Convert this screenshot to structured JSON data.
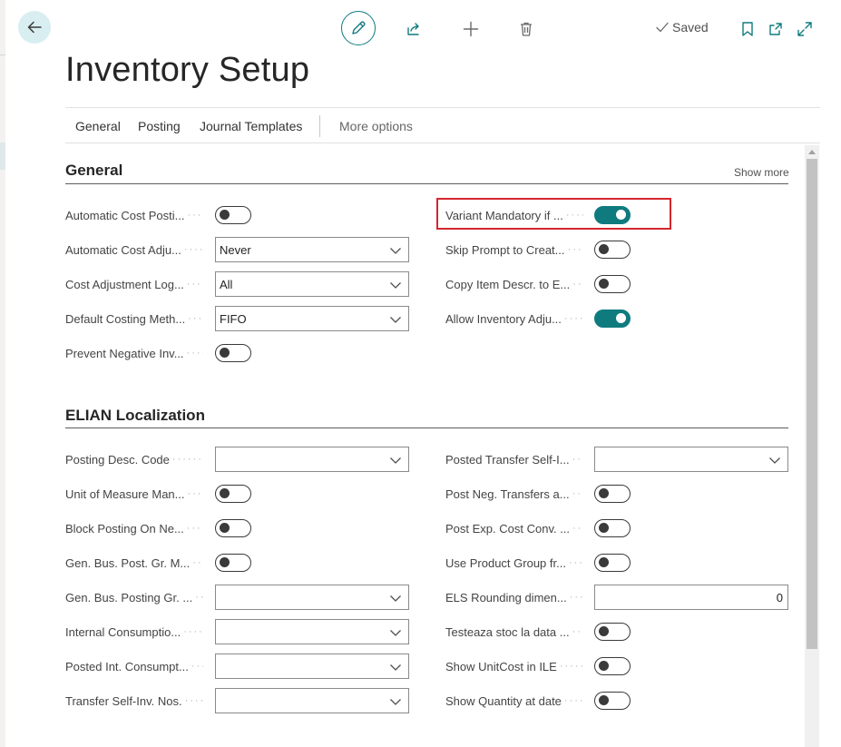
{
  "header": {
    "title": "Inventory Setup",
    "saved_label": "Saved"
  },
  "icons": {
    "back": "arrow-left-icon",
    "edit": "pencil-icon",
    "share": "share-icon",
    "new": "plus-icon",
    "delete": "trash-icon",
    "saved": "check-icon",
    "bookmark": "bookmark-icon",
    "open_new_window": "open-in-new-window-icon",
    "expand": "expand-icon"
  },
  "tabs": [
    {
      "label": "General"
    },
    {
      "label": "Posting"
    },
    {
      "label": "Journal Templates"
    },
    {
      "label": "More options"
    }
  ],
  "general": {
    "title": "General",
    "show_more": "Show more",
    "left_fields": [
      {
        "label": "Automatic Cost Posti...",
        "type": "toggle",
        "value": false
      },
      {
        "label": "Automatic Cost Adju...",
        "type": "select",
        "value": "Never"
      },
      {
        "label": "Cost Adjustment Log...",
        "type": "select",
        "value": "All"
      },
      {
        "label": "Default Costing Meth...",
        "type": "select",
        "value": "FIFO"
      },
      {
        "label": "Prevent Negative Inv...",
        "type": "toggle",
        "value": false
      }
    ],
    "right_fields": [
      {
        "label": "Variant Mandatory if ...",
        "type": "toggle",
        "value": true,
        "highlighted": true
      },
      {
        "label": "Skip Prompt to Creat...",
        "type": "toggle",
        "value": false
      },
      {
        "label": "Copy Item Descr. to E...",
        "type": "toggle",
        "value": false
      },
      {
        "label": "Allow Inventory Adju...",
        "type": "toggle",
        "value": true
      }
    ]
  },
  "elian": {
    "title": "ELIAN Localization",
    "left_fields": [
      {
        "label": "Posting Desc. Code",
        "type": "select",
        "value": ""
      },
      {
        "label": "Unit of Measure Man...",
        "type": "toggle",
        "value": false
      },
      {
        "label": "Block Posting On Ne...",
        "type": "toggle",
        "value": false
      },
      {
        "label": "Gen. Bus. Post. Gr. M...",
        "type": "toggle",
        "value": false
      },
      {
        "label": "Gen. Bus. Posting Gr. ...",
        "type": "select",
        "value": ""
      },
      {
        "label": "Internal Consumptio...",
        "type": "select",
        "value": ""
      },
      {
        "label": "Posted Int. Consumpt...",
        "type": "select",
        "value": ""
      },
      {
        "label": "Transfer Self-Inv. Nos.",
        "type": "select",
        "value": ""
      }
    ],
    "right_fields": [
      {
        "label": "Posted Transfer Self-I...",
        "type": "select",
        "value": ""
      },
      {
        "label": "Post Neg. Transfers a...",
        "type": "toggle",
        "value": false
      },
      {
        "label": "Post Exp. Cost Conv. ...",
        "type": "toggle",
        "value": false
      },
      {
        "label": "Use Product Group fr...",
        "type": "toggle",
        "value": false
      },
      {
        "label": "ELS Rounding dimen...",
        "type": "number",
        "value": "0"
      },
      {
        "label": "Testeaza stoc la data ...",
        "type": "toggle",
        "value": false
      },
      {
        "label": "Show UnitCost in ILE",
        "type": "toggle",
        "value": false
      },
      {
        "label": "Show Quantity at date",
        "type": "toggle",
        "value": false
      }
    ]
  },
  "colors": {
    "accent": "#0f7b7f",
    "highlight_border": "#d4262e"
  }
}
